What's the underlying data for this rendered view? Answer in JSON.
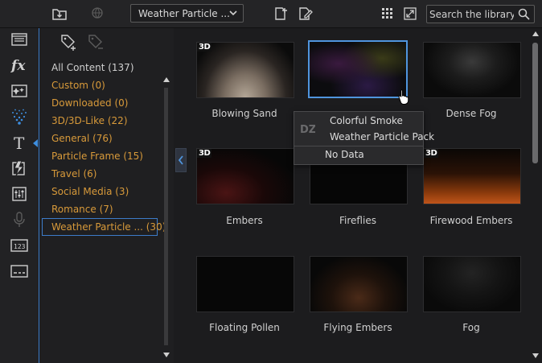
{
  "toolbar": {
    "dropdown_value": "Weather Particle ...",
    "search_placeholder": "Search the library",
    "icons": [
      "import-icon",
      "download-globe-icon",
      "new-folder-icon",
      "edit-icon",
      "grid-view-icon",
      "expand-icon",
      "search-icon"
    ]
  },
  "leftbar": {
    "icons": [
      "media-room-icon",
      "fx-room-icon",
      "pip-room-icon",
      "particle-room-icon",
      "title-room-icon",
      "transition-room-icon",
      "audio-mixing-icon",
      "voice-over-icon",
      "chapter-room-icon",
      "subtitle-room-icon"
    ],
    "active": "particle-room-icon",
    "accent": "#3d8ee0"
  },
  "categories": {
    "items": [
      {
        "label": "All Content (137)"
      },
      {
        "label": "Custom  (0)"
      },
      {
        "label": "Downloaded  (0)"
      },
      {
        "label": "3D/3D-Like  (22)"
      },
      {
        "label": "General  (76)"
      },
      {
        "label": "Particle Frame  (15)"
      },
      {
        "label": "Travel  (6)"
      },
      {
        "label": "Social Media  (3)"
      },
      {
        "label": "Romance  (7)"
      },
      {
        "label": "Weather Particle ...  (30)"
      }
    ],
    "selected_index": 9,
    "category_color": "#d89a3a"
  },
  "library": {
    "tiles": [
      {
        "label": "Blowing Sand",
        "badge": "3D"
      },
      {
        "label": "Colorful Smoke",
        "badge": ""
      },
      {
        "label": "Dense Fog",
        "badge": ""
      },
      {
        "label": "Embers",
        "badge": "3D"
      },
      {
        "label": "Fireflies",
        "badge": ""
      },
      {
        "label": "Firewood Embers",
        "badge": "3D"
      },
      {
        "label": "Floating Pollen",
        "badge": ""
      },
      {
        "label": "Flying Embers",
        "badge": ""
      },
      {
        "label": "Fog",
        "badge": ""
      }
    ],
    "selected_index": 1,
    "selection_color": "#4f95de"
  },
  "tooltip": {
    "title": "Colorful Smoke",
    "pack": "Weather Particle Pack",
    "status": "No Data",
    "icon": "dz-icon"
  }
}
